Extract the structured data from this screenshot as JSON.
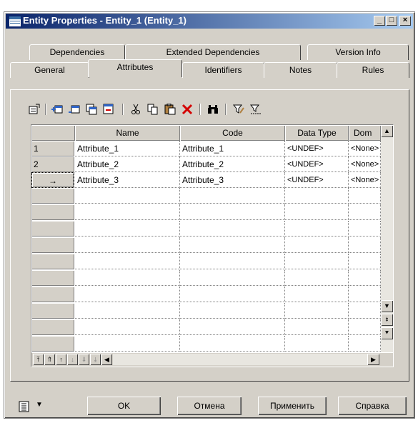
{
  "window": {
    "title": "Entity Properties - Entity_1 (Entity_1)",
    "controls": {
      "minimize": "_",
      "maximize": "□",
      "close": "×"
    }
  },
  "tabs": {
    "row_back": [
      {
        "label": "Dependencies"
      },
      {
        "label": "Extended Dependencies"
      },
      {
        "label": "Version Info"
      }
    ],
    "row_front": [
      {
        "label": "General"
      },
      {
        "label": "Attributes"
      },
      {
        "label": "Identifiers"
      },
      {
        "label": "Notes"
      },
      {
        "label": "Rules"
      }
    ],
    "active": "Attributes"
  },
  "toolbar": {
    "icons": [
      "properties-icon",
      "add-row-icon",
      "insert-row-icon",
      "add-attributes-icon",
      "reuse-attributes-icon",
      "cut-icon",
      "copy-icon",
      "paste-icon",
      "delete-icon",
      "find-icon",
      "filter-icon",
      "clear-filter-icon"
    ]
  },
  "grid": {
    "columns": [
      "Name",
      "Code",
      "Data Type",
      "Dom"
    ],
    "rows": [
      {
        "marker": "1",
        "name": "Attribute_1",
        "code": "Attribute_1",
        "data_type": "<UNDEF>",
        "domain": "<None>"
      },
      {
        "marker": "2",
        "name": "Attribute_2",
        "code": "Attribute_2",
        "data_type": "<UNDEF>",
        "domain": "<None>"
      },
      {
        "marker": "→",
        "name": "Attribute_3",
        "code": "Attribute_3",
        "data_type": "<UNDEF>",
        "domain": "<None>"
      }
    ],
    "empty_rows": 10
  },
  "buttons": {
    "ok": "OK",
    "cancel": "Отмена",
    "apply": "Применить",
    "help": "Справка"
  },
  "colors": {
    "face": "#d4d0c8",
    "title_start": "#0a246a",
    "title_end": "#a6caf0",
    "delete_red": "#d40000"
  }
}
